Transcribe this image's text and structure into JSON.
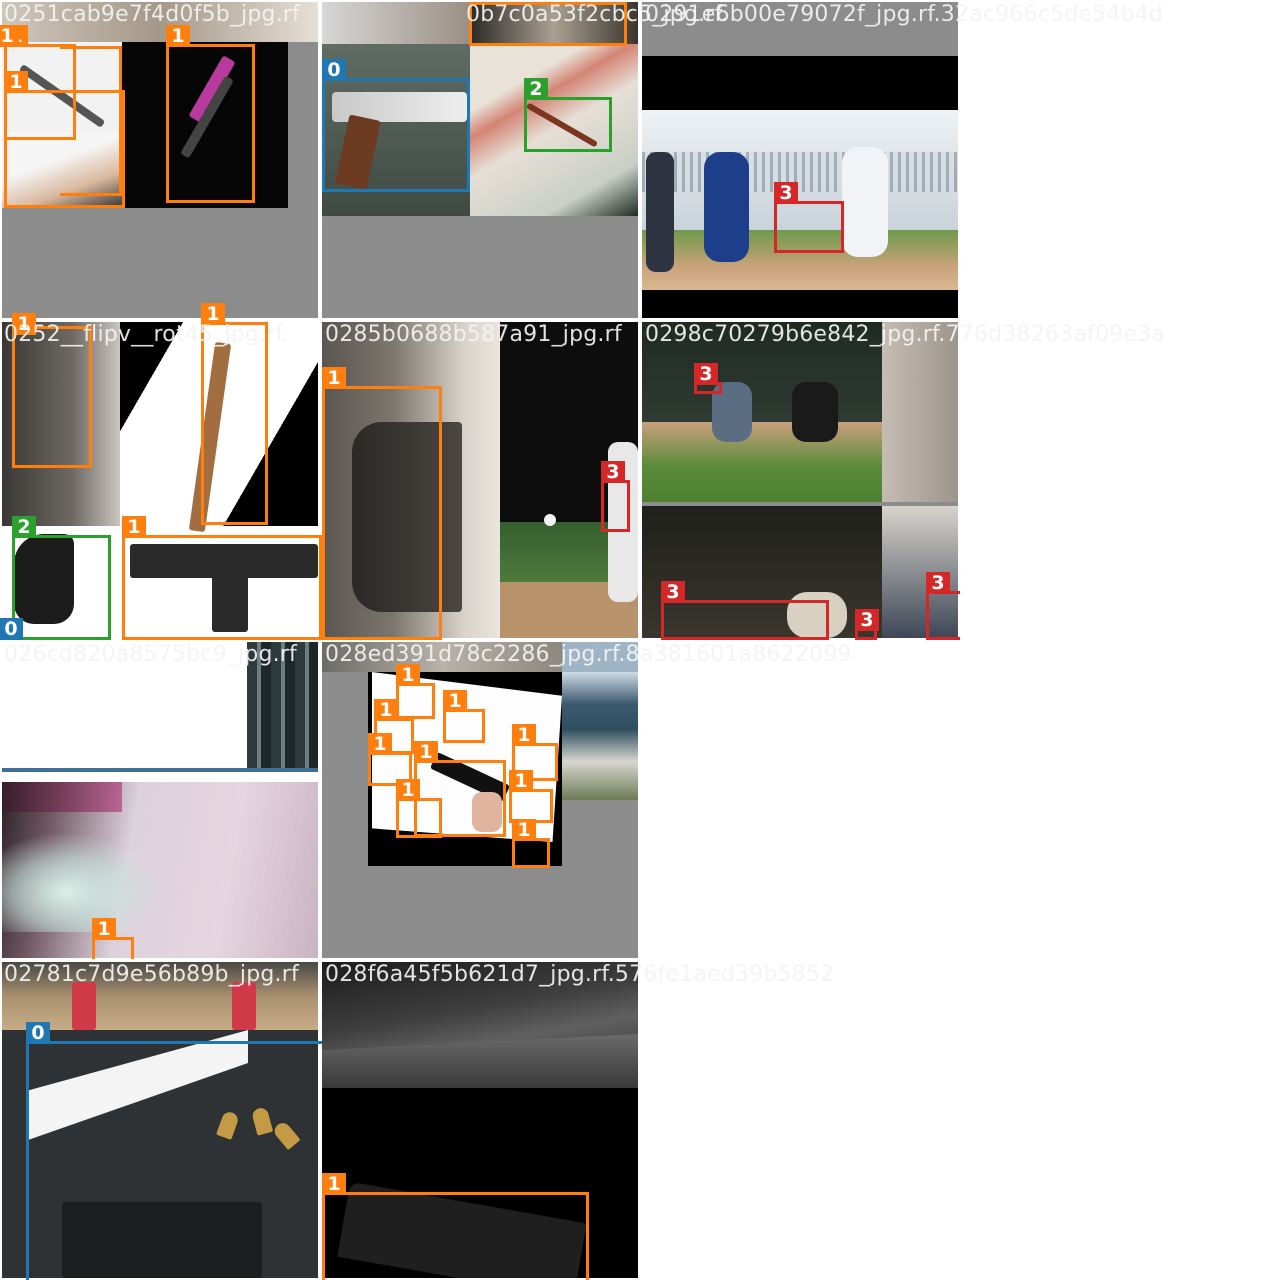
{
  "colors": {
    "class_0": "#1f77b4",
    "class_1": "#ff7f0e",
    "class_2": "#2ca02c",
    "class_3": "#d62728",
    "letterbox_gray": "#8c8c8c"
  },
  "tiles": [
    {
      "filename": "0251cab9e7f4d0f5b_jpg.rf",
      "labels": [
        "1",
        "1",
        "1",
        "1"
      ]
    },
    {
      "filename": "0b7c0a53f2cbc5_jpg.rf.",
      "labels": [
        "0",
        "2",
        "1"
      ]
    },
    {
      "filename": "0291e6b00e79072f_jpg.rf.32ac966c5de54b4d",
      "labels": [
        "3"
      ]
    },
    {
      "filename": "0252__flipv__rot45_jpg.rf.",
      "labels": [
        "1",
        "1",
        "1",
        "2",
        "1",
        "0"
      ]
    },
    {
      "filename": "0285b0688b587a91_jpg.rf",
      "labels": [
        "1",
        "3"
      ]
    },
    {
      "filename": "0298c70279b6e842_jpg.rf.776d38263af09e3a",
      "labels": [
        "3",
        "3",
        "3",
        "3"
      ]
    },
    {
      "filename": "026cd820a8575bc9_jpg.rf",
      "labels": [
        "1"
      ]
    },
    {
      "filename": "028ed391d78c2286_jpg.rf.8a381601a8622099",
      "labels": [
        "1",
        "1",
        "1",
        "1",
        "1",
        "1",
        "1",
        "1",
        "1",
        "1"
      ]
    },
    {
      "filename": "02781c7d9e56b89b_jpg.rf",
      "labels": [
        "0"
      ]
    },
    {
      "filename": "028f6a45f5b621d7_jpg.rf.576fe1aed39b5852",
      "labels": [
        "1"
      ]
    }
  ]
}
